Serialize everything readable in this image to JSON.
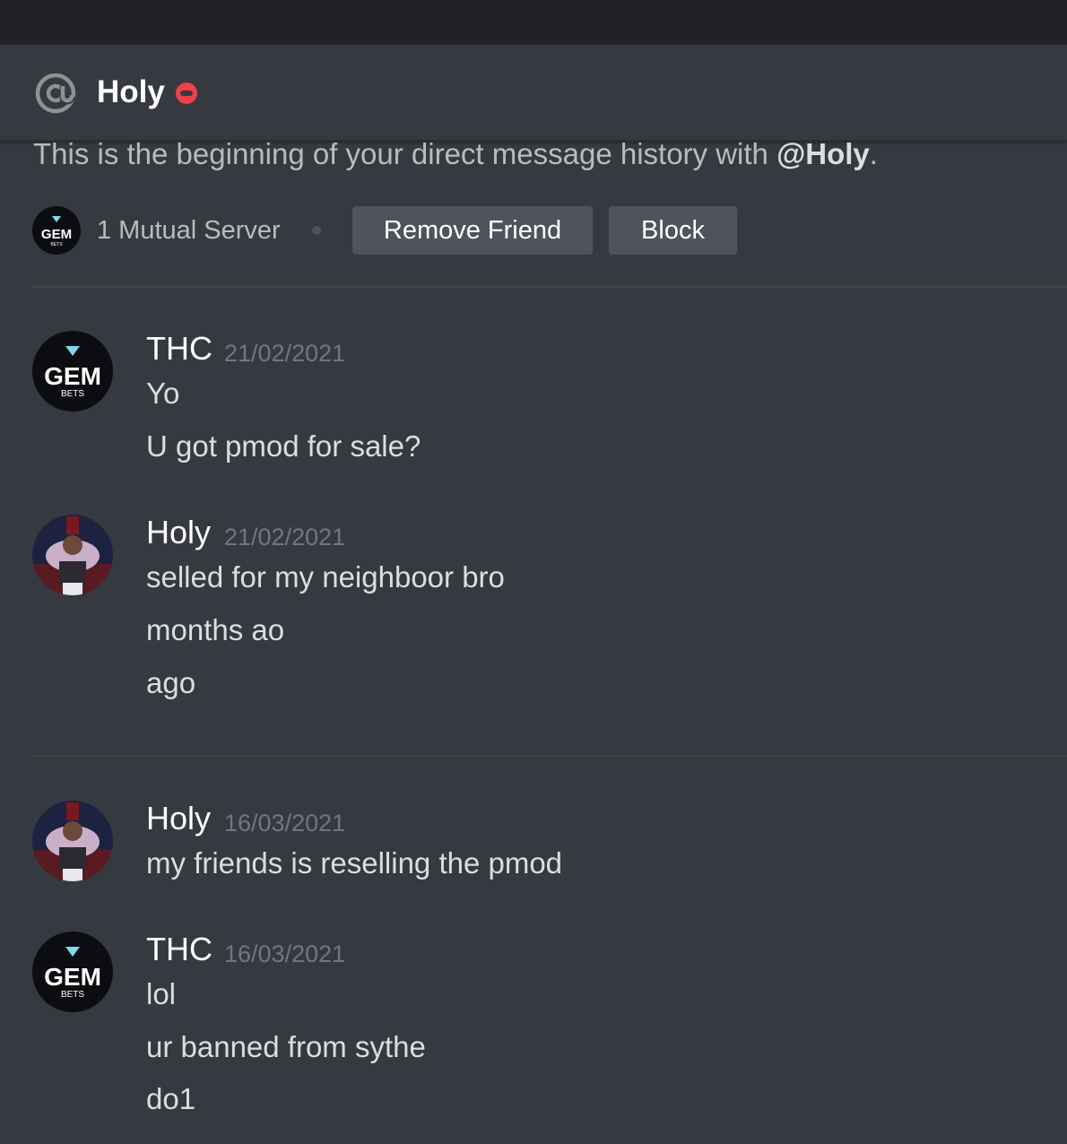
{
  "header": {
    "name": "Holy",
    "status": "do-not-disturb",
    "icon": "at-sign-icon"
  },
  "intro": {
    "prefix": "This is the beginning of your direct message history with ",
    "mention": "@Holy",
    "suffix": "."
  },
  "mutual": {
    "server_icon_text": "GEM",
    "server_icon_subtext": "BETS",
    "text": "1 Mutual Server"
  },
  "actions": {
    "remove_friend": "Remove Friend",
    "block": "Block"
  },
  "messages": [
    {
      "author": "THC",
      "timestamp": "21/02/2021",
      "avatar": "gem-bets-avatar",
      "lines": [
        "Yo",
        "U got pmod for sale?"
      ]
    },
    {
      "author": "Holy",
      "timestamp": "21/02/2021",
      "avatar": "anime-character-avatar",
      "lines": [
        "selled for my neighboor bro",
        "months ao",
        "ago"
      ]
    },
    {
      "author": "Holy",
      "timestamp": "16/03/2021",
      "avatar": "anime-character-avatar",
      "lines": [
        "my friends is reselling the pmod"
      ]
    },
    {
      "author": "THC",
      "timestamp": "16/03/2021",
      "avatar": "gem-bets-avatar",
      "lines": [
        "lol",
        "ur banned from sythe",
        "do1"
      ]
    }
  ],
  "colors": {
    "background": "#36393f",
    "titlebar": "#202225",
    "button": "#4f545c",
    "dnd": "#ed4245",
    "timestamp": "#72767d"
  }
}
